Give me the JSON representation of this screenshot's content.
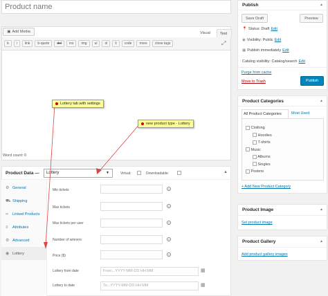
{
  "editor": {
    "title_placeholder": "Product name",
    "add_media_label": "Add Media",
    "tab_visual": "Visual",
    "tab_text": "Text",
    "quicktags": [
      "b",
      "i",
      "link",
      "b-quote",
      "del",
      "ins",
      "img",
      "ul",
      "ol",
      "li",
      "code",
      "more",
      "close tags"
    ],
    "word_count": "Word count: 0"
  },
  "annotations": {
    "lottery_tab_note": "Lottery tab with settings",
    "product_type_note": "new product type - Lottery"
  },
  "product_data": {
    "header": "Product Data —",
    "type_value": "Lottery",
    "virtual_label": "Virtual:",
    "downloadable_label": "Downloadable:",
    "tabs": [
      "General",
      "Shipping",
      "Linked Products",
      "Attributes",
      "Advanced",
      "Lottery"
    ],
    "fields": [
      {
        "label": "Min tickets",
        "placeholder": ""
      },
      {
        "label": "Max tickets",
        "placeholder": ""
      },
      {
        "label": "Max tickets per user",
        "placeholder": ""
      },
      {
        "label": "Number of winners",
        "placeholder": ""
      },
      {
        "label": "Price ($)",
        "placeholder": ""
      },
      {
        "label": "Lottery from date",
        "placeholder": "From...YYYY-MM-DD HH:MM"
      },
      {
        "label": "Lottery to date",
        "placeholder": "To...YYYY-MM-DD HH:MM"
      }
    ]
  },
  "publish": {
    "title": "Publish",
    "save_draft": "Save Draft",
    "preview": "Preview",
    "status": "Status: Draft",
    "visibility": "Visibility: Public",
    "publish_time": "Publish immediately",
    "catalog_visibility": "Catalog visibility: Catalog/search",
    "edit": "Edit",
    "purge_cache": "Purge from cache",
    "move_trash": "Move to Trash",
    "publish_button": "Publish"
  },
  "categories": {
    "title": "Product Categories",
    "tab_all": "All Product Categories",
    "tab_most_used": "Most Used",
    "items": [
      {
        "label": "Clothing",
        "level": 0
      },
      {
        "label": "Hoodies",
        "level": 1
      },
      {
        "label": "T-shirts",
        "level": 1
      },
      {
        "label": "Music",
        "level": 0
      },
      {
        "label": "Albums",
        "level": 1
      },
      {
        "label": "Singles",
        "level": 1
      },
      {
        "label": "Posters",
        "level": 0
      }
    ],
    "add_new": "+ Add New Product Category"
  },
  "product_image": {
    "title": "Product Image",
    "set_link": "Set product image"
  },
  "product_gallery": {
    "title": "Product Gallery",
    "add_link": "Add product gallery images"
  },
  "colors": {
    "link": "#0073aa",
    "publish_button": "#0085ba",
    "trash": "#a00",
    "tooltip": "#ffff99",
    "arrow": "#d44"
  }
}
